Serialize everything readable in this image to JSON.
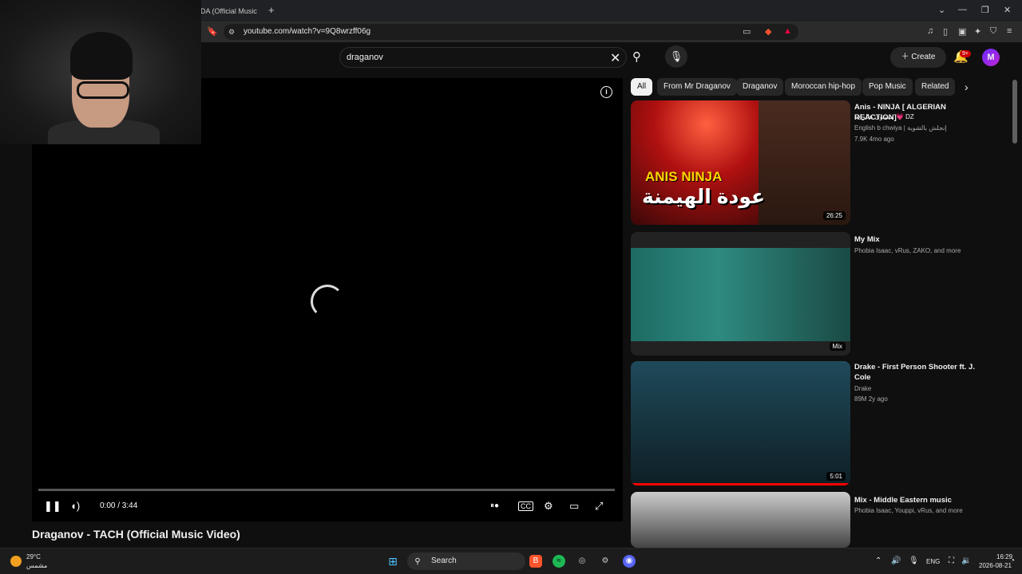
{
  "browser": {
    "tab_title": "YDA (Official Music",
    "new_tab": "+",
    "url": "youtube.com/watch?v=9Q8wrzff06g",
    "window_controls": [
      "⌄",
      "—",
      "❐",
      "✕"
    ]
  },
  "header": {
    "search_value": "draganov",
    "create_label": "Create",
    "notification_badge": "9+",
    "avatar_letter": "M"
  },
  "player": {
    "time": "0:00 / 3:44",
    "title": "Draganov - TACH (Official Music Video)",
    "progress": 0
  },
  "chips": [
    "All",
    "From Mr Draganov",
    "Draganov",
    "Moroccan hip-hop",
    "Pop Music",
    "Related"
  ],
  "recommendations": [
    {
      "title": "Anis - NINJA   [ ALGERIAN REACTION]",
      "subtitle": "مستوى هالراب 💗 DZ",
      "channel": "English b chwiya | إنجلش بالشوية",
      "meta": "7.9K  4mo ago",
      "duration": "26:25",
      "thumb_text_top": "ANIS NINJA",
      "thumb_text_bottom": "عودة الهيمنة"
    },
    {
      "title": "My Mix",
      "channel": "Phobia Isaac, vRus, ZAKO, and more",
      "duration": "Mix"
    },
    {
      "title": "Drake - First Person Shooter ft. J. Cole",
      "channel": "Drake",
      "meta": "89M  2y ago",
      "duration": "5:01"
    },
    {
      "title": "Mix - Middle Eastern music",
      "channel": "Phobia Isaac, Youppi, vRus, and more"
    }
  ],
  "taskbar": {
    "temp": "29°C",
    "weather_desc": "مشمس",
    "search_label": "Search",
    "lang": "ENG",
    "time": "16:29",
    "date": "2026-08-21"
  }
}
